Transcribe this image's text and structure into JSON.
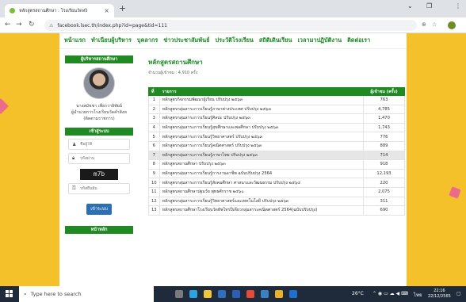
{
  "browser": {
    "tab_title": "หลักสูตรสถานศึกษา : โรงเรียนวัดหงิ",
    "tab_close": "×",
    "new_tab": "+",
    "url": "facebook.lsec.th/index.php?id=page&tid=111",
    "win_min": "⌄",
    "win_max": "❐",
    "win_close": "⋮"
  },
  "topnav": [
    "หน้าแรก",
    "ทำเนียบผู้บริหาร",
    "บุคลากร",
    "ข่าวประชาสัมพันธ์",
    "ประวัติโรงเรียน",
    "สถิติเดินเรียน",
    "เวลามาปฏิบัติงาน",
    "ติดต่อเรา"
  ],
  "sidebar": {
    "admin_header": "ผู้บริหารสถานศึกษา",
    "director_name": "นางสมัชชา เพียรวายิพัยย์",
    "director_role": "ผู้อำนวยการโรงเรียนวัดคำสิงห",
    "director_area": "(ติดตามราชการ)",
    "login_header": "เข้าสู่ระบบ",
    "username_placeholder": "ชื่อผู้ใช้",
    "password_placeholder": "รหัสผ่าน",
    "captcha_text": "m7b",
    "captcha_placeholder": "รหัสยืนยัน",
    "login_button": "เข้าระบบ",
    "menu_header": "หน้าหลัก"
  },
  "main": {
    "title": "หลักสูตรสถานศึกษา",
    "visits": "จำนวนผู้เข้าชม : 4,910 ครั้ง",
    "columns": [
      "ที่",
      "รายการ",
      "ผู้เข้าชม (ครั้ง)"
    ],
    "rows": [
      {
        "no": "1",
        "name": "หลักสูตรกิจกรรมพัฒนาผู้เรียน ปรับปรุง ๒๕๖๓",
        "views": "763"
      },
      {
        "no": "2",
        "name": "หลักสูตรกลุ่มสาระการเรียนรู้ภาษาต่างประเทศ ปรับปรุง ๒๕๖๓",
        "views": "4,785"
      },
      {
        "no": "3",
        "name": "หลักสูตรกลุ่มสาระการเรียนรู้ศิลปะ ปรับปรุง ๒๕๖๓",
        "views": "1,470"
      },
      {
        "no": "4",
        "name": "หลักสูตรกลุ่มสาระการเรียนรู้สุขศึกษาและพลศึกษา ปรับปรุง ๒๕๖๓",
        "views": "1,743"
      },
      {
        "no": "5",
        "name": "หลักสูตรกลุ่มสาระการเรียนรู้วิทยาศาสตร์ ปรับปรุง ๒๕๖๓",
        "views": "776"
      },
      {
        "no": "6",
        "name": "หลักสูตรกลุ่มสาระการเรียนรู้คณิตศาสตร์ ปรับปรุง ๒๕๖๓",
        "views": "889"
      },
      {
        "no": "7",
        "name": "หลักสูตรกลุ่มสาระการเรียนรู้ภาษาไทย ปรับปรุง ๒๕๖๓",
        "views": "714"
      },
      {
        "no": "8",
        "name": "หลักสูตรสถานศึกษา ปรับปรุง ๒๕๖๓",
        "views": "918"
      },
      {
        "no": "9",
        "name": "หลักสูตรกลุ่มสาระการเรียนรู้การงานอาชีพ ฉบับปรับปรุง 2564",
        "views": "12,193"
      },
      {
        "no": "10",
        "name": "หลักสูตรกลุ่มสาระการเรียนรู้สังคมศึกษา ศาสนาและวัฒนธรรม ปรับปรุง ๒๕๖๔",
        "views": "220"
      },
      {
        "no": "11",
        "name": "หลักสูตรสถานศึกษาปฐมวัย พุทธศักราช ๒๕๖๐",
        "views": "2,075"
      },
      {
        "no": "12",
        "name": "หลักสูตรกลุ่มสาระการเรียนรู้วิทยาศาสตร์และเทคโนโลยี ปรับปรุง ๒๕๖๓",
        "views": "311"
      },
      {
        "no": "13",
        "name": "หลักสูตรสถานศึกษาโรงเรียนวัดทัพไทรปีเดียวกลุ่มสาระคณิตศาสตร์ 2564(ฉบับปรับปรุง)",
        "views": "690"
      }
    ],
    "highlight_row": 7
  },
  "taskbar": {
    "search_placeholder": "Type here to search",
    "weather": "26°C",
    "language": "ไทย",
    "time": "22:16",
    "date": "22/12/2565"
  },
  "colors": {
    "brand_green": "#1f8a22",
    "page_background": "#f4c12a",
    "accent_pink": "#ec6a8c",
    "login_button": "#2d6fb4"
  }
}
